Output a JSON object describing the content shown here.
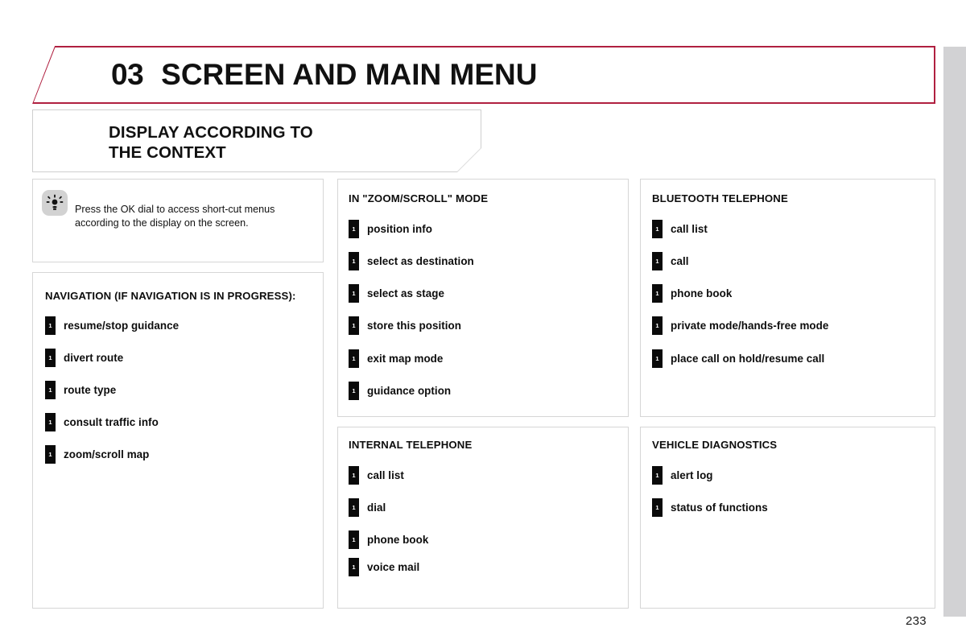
{
  "document": {
    "page_number": "233",
    "accent_color": "#b02040",
    "panel_border_color": "#d6d6d6"
  },
  "header": {
    "chapter_number": "03",
    "chapter_title": "SCREEN AND MAIN MENU"
  },
  "subtitle": {
    "text": "DISPLAY ACCORDING TO\nTHE CONTEXT"
  },
  "tip": {
    "icon": "tip-bulb-icon",
    "text": "Press the OK dial to access short-cut menus according to the display on the screen."
  },
  "panels": [
    {
      "id": "navigation",
      "title": "NAVIGATION (IF NAVIGATION IS IN PROGRESS):",
      "items": [
        {
          "marker": "1",
          "label": "resume/stop guidance"
        },
        {
          "marker": "1",
          "label": "divert route"
        },
        {
          "marker": "1",
          "label": "route type"
        },
        {
          "marker": "1",
          "label": "consult traffic info"
        },
        {
          "marker": "1",
          "label": "zoom/scroll map"
        }
      ]
    },
    {
      "id": "zoom-scroll-mode",
      "title": "IN \"ZOOM/SCROLL\" MODE",
      "items": [
        {
          "marker": "1",
          "label": "position info"
        },
        {
          "marker": "1",
          "label": "select as destination"
        },
        {
          "marker": "1",
          "label": "select as stage"
        },
        {
          "marker": "1",
          "label": "store this position"
        },
        {
          "marker": "1",
          "label": "exit map mode"
        },
        {
          "marker": "1",
          "label": "guidance option"
        }
      ]
    },
    {
      "id": "internal-telephone",
      "title": "INTERNAL TELEPHONE",
      "items": [
        {
          "marker": "1",
          "label": "call list"
        },
        {
          "marker": "1",
          "label": "dial"
        },
        {
          "marker": "1",
          "label": "phone book"
        },
        {
          "marker": "1",
          "label": "voice mail"
        }
      ]
    },
    {
      "id": "bluetooth-telephone",
      "title": "BLUETOOTH TELEPHONE",
      "items": [
        {
          "marker": "1",
          "label": "call list"
        },
        {
          "marker": "1",
          "label": "call"
        },
        {
          "marker": "1",
          "label": "phone book"
        },
        {
          "marker": "1",
          "label": "private mode/hands-free mode"
        },
        {
          "marker": "1",
          "label": "place call on hold/resume call"
        }
      ]
    },
    {
      "id": "vehicle-diagnostics",
      "title": "VEHICLE DIAGNOSTICS",
      "items": [
        {
          "marker": "1",
          "label": "alert log"
        },
        {
          "marker": "1",
          "label": "status of functions"
        }
      ]
    }
  ]
}
